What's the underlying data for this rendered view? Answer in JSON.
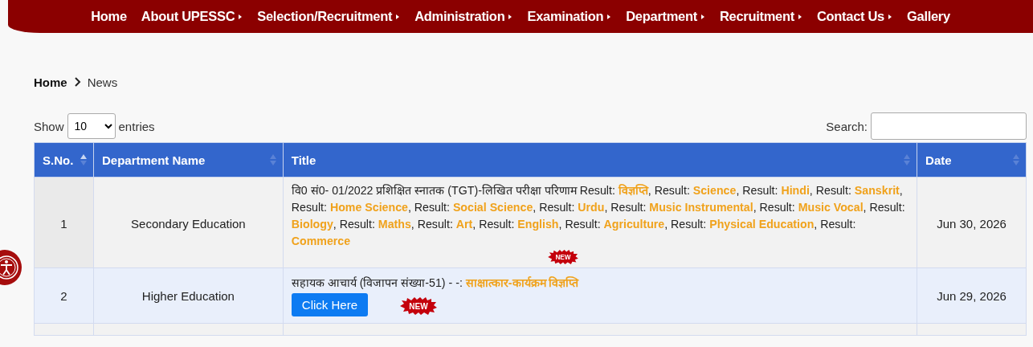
{
  "nav": {
    "items": [
      {
        "label": "Home",
        "submenu": false
      },
      {
        "label": "About UPESSC",
        "submenu": true
      },
      {
        "label": "Selection/Recruitment",
        "submenu": true
      },
      {
        "label": "Administration",
        "submenu": true
      },
      {
        "label": "Examination",
        "submenu": true
      },
      {
        "label": "Department",
        "submenu": true
      },
      {
        "label": "Recruitment",
        "submenu": true
      },
      {
        "label": "Contact Us",
        "submenu": true
      },
      {
        "label": "Gallery",
        "submenu": false
      }
    ]
  },
  "breadcrumb": [
    "Home",
    "News"
  ],
  "length_control": {
    "before": "Show",
    "value": "10",
    "after": "entries"
  },
  "search": {
    "label": "Search:"
  },
  "table": {
    "columns": [
      {
        "label": "S.No.",
        "sorted": true
      },
      {
        "label": "Department Name",
        "sorted": false
      },
      {
        "label": "Title",
        "sorted": false
      },
      {
        "label": "Date",
        "sorted": false
      }
    ],
    "rows": [
      {
        "sno": "1",
        "department": "Secondary Education",
        "title": [
          {
            "kind": "text",
            "text": "वि0 सं0- 01/2022 प्रशिक्षित स्नातक (TGT)-लिखित परीक्षा परिणाम Result: "
          },
          {
            "kind": "link",
            "text": "विज्ञप्ति"
          },
          {
            "kind": "text",
            "text": ", Result: "
          },
          {
            "kind": "link",
            "text": "Science"
          },
          {
            "kind": "text",
            "text": ", Result: "
          },
          {
            "kind": "link",
            "text": "Hindi"
          },
          {
            "kind": "text",
            "text": ", Result: "
          },
          {
            "kind": "link",
            "text": "Sanskrit"
          },
          {
            "kind": "text",
            "text": ", Result: "
          },
          {
            "kind": "link",
            "text": "Home Science"
          },
          {
            "kind": "text",
            "text": ", Result: "
          },
          {
            "kind": "link",
            "text": "Social Science"
          },
          {
            "kind": "text",
            "text": ", Result: "
          },
          {
            "kind": "link",
            "text": "Urdu"
          },
          {
            "kind": "text",
            "text": ", Result: "
          },
          {
            "kind": "link",
            "text": "Music Instrumental"
          },
          {
            "kind": "text",
            "text": ", Result: "
          },
          {
            "kind": "link",
            "text": "Music Vocal"
          },
          {
            "kind": "text",
            "text": ", Result: "
          },
          {
            "kind": "link",
            "text": "Biology"
          },
          {
            "kind": "text",
            "text": ", Result: "
          },
          {
            "kind": "link",
            "text": "Maths"
          },
          {
            "kind": "text",
            "text": ", Result: "
          },
          {
            "kind": "link",
            "text": "Art"
          },
          {
            "kind": "text",
            "text": ", Result: "
          },
          {
            "kind": "link",
            "text": "English"
          },
          {
            "kind": "text",
            "text": ", Result: "
          },
          {
            "kind": "link",
            "text": "Agriculture"
          },
          {
            "kind": "text",
            "text": ", Result: "
          },
          {
            "kind": "link",
            "text": "Physical Education"
          },
          {
            "kind": "text",
            "text": ", Result: "
          },
          {
            "kind": "link",
            "text": "Commerce"
          }
        ],
        "badge": "NEW",
        "date": "Jun 30, 2026"
      },
      {
        "sno": "2",
        "department": "Higher Education",
        "title": [
          {
            "kind": "text",
            "text": "सहायक आचार्य (विजापन संख्या-51) - -: "
          },
          {
            "kind": "link",
            "text": "साक्षात्कार-कार्यक्रम विज्ञप्ति"
          }
        ],
        "button": "Click Here",
        "badge": "NEW",
        "date": "Jun 29, 2026"
      }
    ]
  }
}
